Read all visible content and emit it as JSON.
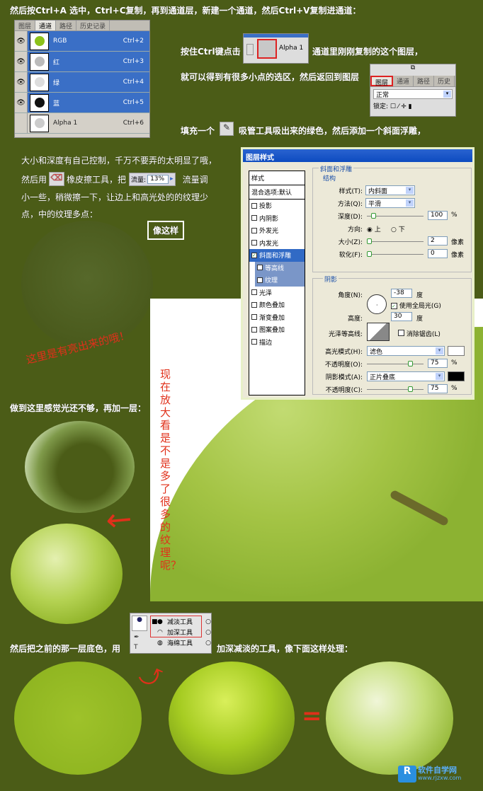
{
  "step1": "然后按Ctrl+A 选中，Ctrl+C复制，再到通道层，新建一个通道，然后Ctrl+V复制进通道：",
  "channels_panel": {
    "tabs": [
      "图层",
      "通道",
      "路径",
      "历史记录"
    ],
    "rows": [
      {
        "name": "RGB",
        "key": "Ctrl+2",
        "color": "#8cc21a"
      },
      {
        "name": "红",
        "key": "Ctrl+3",
        "color": "#bbbbbb"
      },
      {
        "name": "绿",
        "key": "Ctrl+4",
        "color": "#dddddd"
      },
      {
        "name": "蓝",
        "key": "Ctrl+5",
        "color": "#111111"
      },
      {
        "name": "Alpha 1",
        "key": "Ctrl+6",
        "color": "#cccccc"
      }
    ]
  },
  "step2a": "按住Ctrl键点击",
  "alpha_thumb_label": "Alpha 1",
  "step2b": "通道里刚刚复制的这个图层，",
  "step3": "就可以得到有很多小点的选区，然后返回到图层",
  "layers_panel": {
    "tabs": [
      "图层",
      "通道",
      "路径",
      "历史"
    ],
    "blend": "正常",
    "lock": "锁定:"
  },
  "step4a": "填充一个",
  "step4b": "吸管工具吸出来的绿色，然后添加一个斜面浮雕，",
  "para": {
    "l1": "大小和深度有自己控制，千万不要弄的太明显了哦，",
    "l2a": "然后用",
    "l2b": "橡皮擦工具，把",
    "flow_label": "流量:",
    "flow_value": "13%",
    "l2c": "流量调",
    "l3": "小一些，稍微擦一下，让边上和高光处的的纹理少",
    "l4": "点，中的纹理多点："
  },
  "callout": "像这样",
  "note1": "这里是有亮出来的哦！",
  "note2": "现在放大看是不是多了很多的纹理呢？",
  "dialog": {
    "title": "图层样式",
    "styles_header": "样式",
    "blend_opts": "混合选项:默认",
    "effects": [
      {
        "label": "投影",
        "checked": false
      },
      {
        "label": "内阴影",
        "checked": false
      },
      {
        "label": "外发光",
        "checked": false
      },
      {
        "label": "内发光",
        "checked": false
      },
      {
        "label": "斜面和浮雕",
        "checked": true
      },
      {
        "label": "等高线",
        "checked": false
      },
      {
        "label": "纹理",
        "checked": false
      },
      {
        "label": "光泽",
        "checked": false
      },
      {
        "label": "颜色叠加",
        "checked": false
      },
      {
        "label": "渐变叠加",
        "checked": false
      },
      {
        "label": "图案叠加",
        "checked": false
      },
      {
        "label": "描边",
        "checked": false
      }
    ],
    "section": "斜面和浮雕",
    "structure": "结构",
    "style_label": "样式(T):",
    "style_value": "内斜面",
    "technique_label": "方法(Q):",
    "technique_value": "平滑",
    "depth_label": "深度(D):",
    "depth_value": "100",
    "pct": "%",
    "direction_label": "方向:",
    "dir_up": "上",
    "dir_down": "下",
    "size_label": "大小(Z):",
    "size_value": "2",
    "px": "像素",
    "soften_label": "软化(F):",
    "soften_value": "0",
    "shading": "阴影",
    "angle_label": "角度(N):",
    "angle_value": "-38",
    "deg": "度",
    "global_light": "使用全局光(G)",
    "altitude_label": "高度:",
    "altitude_value": "30",
    "gloss_label": "光泽等高线:",
    "antialias": "消除锯齿(L)",
    "highlight_label": "高光模式(H):",
    "highlight_value": "滤色",
    "opacity1_label": "不透明度(O):",
    "opacity1_value": "75",
    "shadow_label": "阴影模式(A):",
    "shadow_value": "正片叠底",
    "opacity2_label": "不透明度(C):",
    "opacity2_value": "75",
    "highlight_color": "#ffffff",
    "shadow_color": "#000000"
  },
  "step5": "做到这里感觉光还不够，再加一层：",
  "step6a": "然后把之前的那一层底色，用",
  "tools": [
    "减淡工具",
    "加深工具",
    "海绵工具"
  ],
  "step6b": "加深减淡的工具，像下面这样处理：",
  "equals": "=",
  "logo": {
    "brand": "软件自学网",
    "url": "www.rjzxw.com"
  },
  "colors": {
    "bg": "#4b5c17",
    "apple": "#9cc430",
    "note": "#e0301a"
  }
}
